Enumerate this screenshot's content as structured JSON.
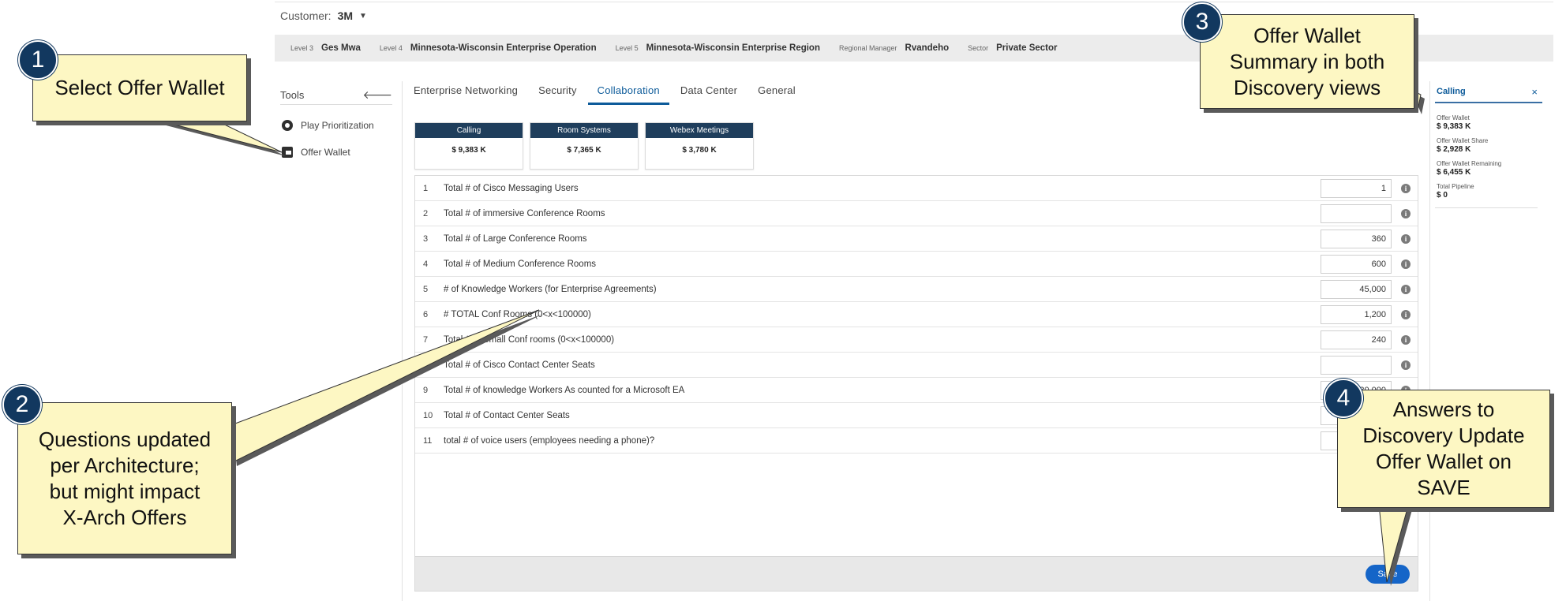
{
  "customer": {
    "label": "Customer:",
    "value": "3M"
  },
  "levels": [
    {
      "label": "Level 3",
      "value": "Ges Mwa"
    },
    {
      "label": "Level 4",
      "value": "Minnesota-Wisconsin Enterprise Operation"
    },
    {
      "label": "Level 5",
      "value": "Minnesota-Wisconsin Enterprise Region"
    },
    {
      "label": "Regional Manager",
      "value": "Rvandeho"
    },
    {
      "label": "Sector",
      "value": "Private Sector"
    }
  ],
  "tools": {
    "title": "Tools",
    "items": [
      {
        "label": "Play Prioritization",
        "icon": "play-prioritization-icon"
      },
      {
        "label": "Offer Wallet",
        "icon": "offer-wallet-icon"
      }
    ]
  },
  "tabs": [
    {
      "label": "Enterprise Networking",
      "active": false
    },
    {
      "label": "Security",
      "active": false
    },
    {
      "label": "Collaboration",
      "active": true
    },
    {
      "label": "Data Center",
      "active": false
    },
    {
      "label": "General",
      "active": false
    }
  ],
  "cards": [
    {
      "title": "Calling",
      "value": "$ 9,383 K"
    },
    {
      "title": "Room Systems",
      "value": "$ 7,365 K"
    },
    {
      "title": "Webex Meetings",
      "value": "$ 3,780 K"
    }
  ],
  "questions": [
    {
      "num": "1",
      "text": "Total # of Cisco Messaging Users",
      "value": "1"
    },
    {
      "num": "2",
      "text": "Total # of immersive Conference Rooms",
      "value": ""
    },
    {
      "num": "3",
      "text": "Total # of Large Conference Rooms",
      "value": "360"
    },
    {
      "num": "4",
      "text": "Total # of Medium Conference Rooms",
      "value": "600"
    },
    {
      "num": "5",
      "text": "# of Knowledge Workers (for Enterprise Agreements)",
      "value": "45,000"
    },
    {
      "num": "6",
      "text": "# TOTAL Conf Rooms (0<x<100000)",
      "value": "1,200"
    },
    {
      "num": "7",
      "text": "Total # of Small Conf rooms (0<x<100000)",
      "value": "240"
    },
    {
      "num": "8",
      "text": "Total # of Cisco Contact Center Seats",
      "value": ""
    },
    {
      "num": "9",
      "text": "Total # of knowledge Workers As counted for a Microsoft EA",
      "value": "30,000"
    },
    {
      "num": "10",
      "text": "Total # of Contact Center Seats",
      "value": ""
    },
    {
      "num": "11",
      "text": "total # of voice users (employees needing a phone)?",
      "value": ""
    }
  ],
  "save_label": "Save",
  "summary": {
    "title": "Calling",
    "close": "×",
    "items": [
      {
        "label": "Offer Wallet",
        "value": "$ 9,383 K"
      },
      {
        "label": "Offer Wallet Share",
        "value": "$ 2,928 K"
      },
      {
        "label": "Offer Wallet Remaining",
        "value": "$ 6,455 K"
      },
      {
        "label": "Total Pipeline",
        "value": "$ 0"
      }
    ]
  },
  "annotations": {
    "c1": {
      "badge": "1",
      "text": "Select Offer Wallet"
    },
    "c2": {
      "badge": "2",
      "text": "Questions updated per Architecture; but might impact X-Arch Offers"
    },
    "c3": {
      "badge": "3",
      "text": "Offer Wallet Summary in both Discovery views"
    },
    "c4": {
      "badge": "4",
      "text": "Answers to Discovery Update Offer Wallet on SAVE"
    }
  },
  "colors": {
    "accent": "#0d5b9a",
    "card_header": "#1f3e5c",
    "callout": "#fdf7c3",
    "badge": "#12385f",
    "save": "#1565c8"
  }
}
